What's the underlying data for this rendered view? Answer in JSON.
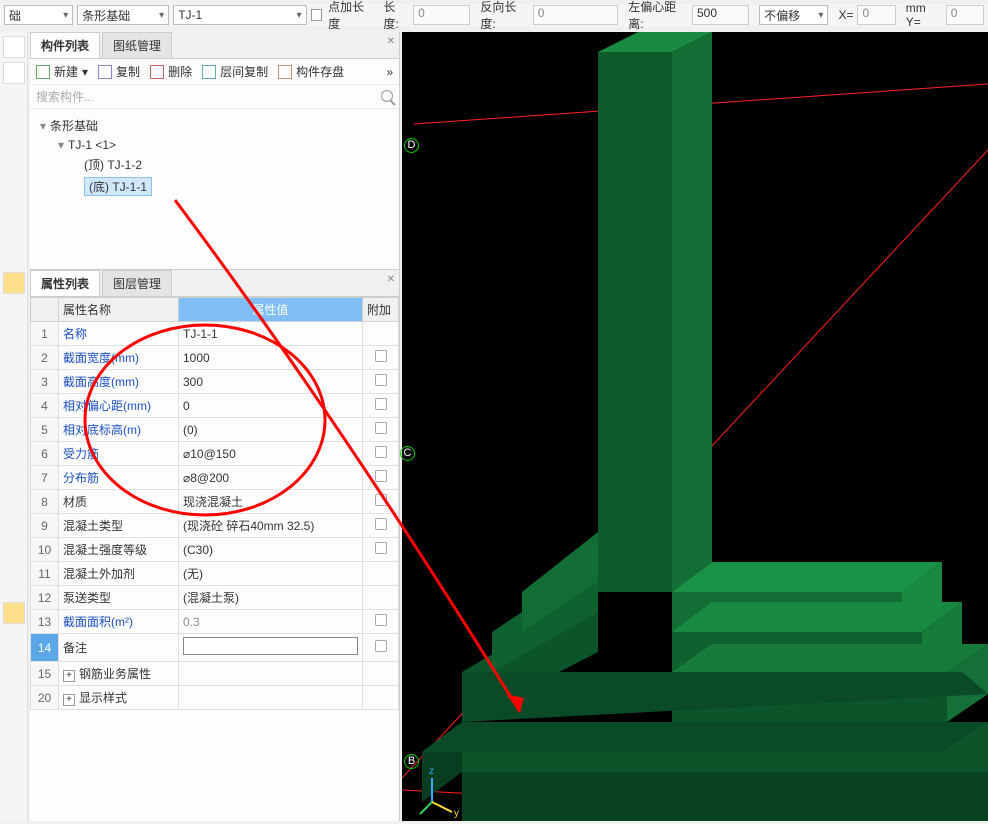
{
  "topbar": {
    "dd1": "础",
    "dd2": "条形基础",
    "dd3": "TJ-1",
    "chk_label": "点加长度",
    "len_label": "长度:",
    "len_value": "0",
    "revlen_label": "反向长度:",
    "revlen_value": "0",
    "offset_label": "左偏心距离:",
    "offset_value": "500",
    "shift_dd": "不偏移",
    "x_label": "X=",
    "x_value": "0",
    "mmY_label": "mm Y=",
    "mmY_value": "0"
  },
  "tabs_top": {
    "components": "构件列表",
    "drawings": "图纸管理"
  },
  "toolbar": {
    "new": "新建",
    "copy": "复制",
    "delete": "删除",
    "layercopy": "层间复制",
    "save": "构件存盘",
    "more": "»"
  },
  "search_placeholder": "搜索构件...",
  "tree": {
    "root": "条形基础",
    "group": "TJ-1  <1>",
    "child_top": "(顶)  TJ-1-2",
    "child_bot": "(底)  TJ-1-1"
  },
  "tabs_bottom": {
    "props": "属性列表",
    "layers": "图层管理"
  },
  "cols": {
    "name": "属性名称",
    "value": "属性值",
    "extra": "附加"
  },
  "rows": [
    {
      "n": "1",
      "name": "名称",
      "value": "TJ-1-1",
      "blue": true,
      "chk": false
    },
    {
      "n": "2",
      "name": "截面宽度(mm)",
      "value": "1000",
      "blue": true,
      "chk": true
    },
    {
      "n": "3",
      "name": "截面高度(mm)",
      "value": "300",
      "blue": true,
      "chk": true
    },
    {
      "n": "4",
      "name": "相对偏心距(mm)",
      "value": "0",
      "blue": true,
      "chk": true
    },
    {
      "n": "5",
      "name": "相对底标高(m)",
      "value": "(0)",
      "blue": true,
      "chk": true
    },
    {
      "n": "6",
      "name": "受力筋",
      "value": "⌀10@150",
      "blue": true,
      "chk": true
    },
    {
      "n": "7",
      "name": "分布筋",
      "value": "⌀8@200",
      "blue": true,
      "chk": true
    },
    {
      "n": "8",
      "name": "材质",
      "value": "现浇混凝土",
      "blue": false,
      "chk": true
    },
    {
      "n": "9",
      "name": "混凝土类型",
      "value": "(现浇砼 碎石40mm 32.5)",
      "blue": false,
      "chk": true
    },
    {
      "n": "10",
      "name": "混凝土强度等级",
      "value": "(C30)",
      "blue": false,
      "chk": true
    },
    {
      "n": "11",
      "name": "混凝土外加剂",
      "value": "(无)",
      "blue": false,
      "chk": false
    },
    {
      "n": "12",
      "name": "泵送类型",
      "value": "(混凝土泵)",
      "blue": false,
      "chk": false
    },
    {
      "n": "13",
      "name": "截面面积(m²)",
      "value": "0.3",
      "blue": true,
      "grey": true,
      "chk": true
    },
    {
      "n": "14",
      "name": "备注",
      "value": "",
      "blue": false,
      "sel": true,
      "edit": true,
      "chk": true
    },
    {
      "n": "15",
      "name": "钢筋业务属性",
      "value": "",
      "exp": true
    },
    {
      "n": "20",
      "name": "显示样式",
      "value": "",
      "exp": true
    }
  ],
  "markers": {
    "D": "D",
    "C": "C",
    "B": "B"
  },
  "axis": {
    "z": "z",
    "y": "y"
  }
}
